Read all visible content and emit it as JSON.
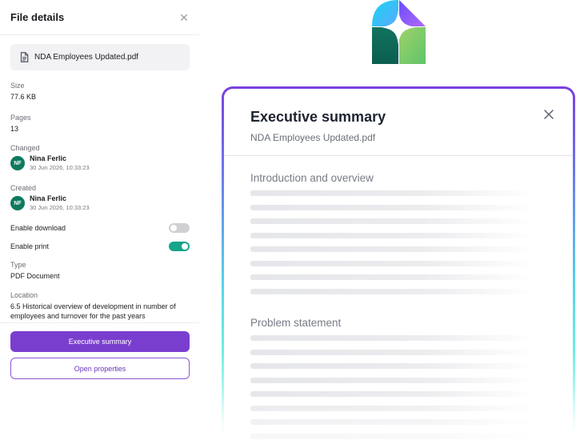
{
  "panel": {
    "title": "File details",
    "close_icon": "close-icon",
    "file": {
      "name": "NDA Employees Updated.pdf",
      "icon": "file-document-icon"
    },
    "size": {
      "label": "Size",
      "value": "77.6 KB"
    },
    "pages": {
      "label": "Pages",
      "value": "13"
    },
    "changed": {
      "label": "Changed",
      "initials": "NF",
      "name": "Nina Ferlic",
      "date": "30 Jun 2026, 10:33:23"
    },
    "created": {
      "label": "Created",
      "initials": "NF",
      "name": "Nina Ferlic",
      "date": "30 Jun 2026, 10:33:23"
    },
    "enable_download": {
      "label": "Enable download",
      "enabled": false
    },
    "enable_print": {
      "label": "Enable print",
      "enabled": true
    },
    "type": {
      "label": "Type",
      "value": "PDF Document"
    },
    "location": {
      "label": "Location",
      "value": "6.5 Historical overview of development in number of employees and turnover for the past years"
    },
    "primary_button": "Executive summary",
    "secondary_button": "Open properties"
  },
  "logo": {
    "icon": "brand-logo-icon"
  },
  "summary": {
    "title": "Executive summary",
    "subtitle": "NDA Employees Updated.pdf",
    "close_icon": "close-icon",
    "sections": [
      {
        "title": "Introduction and overview"
      },
      {
        "title": "Problem statement"
      }
    ]
  },
  "colors": {
    "accent": "#7a3ecf",
    "toggle_on": "#17a58b",
    "avatar": "#0f7a60"
  }
}
